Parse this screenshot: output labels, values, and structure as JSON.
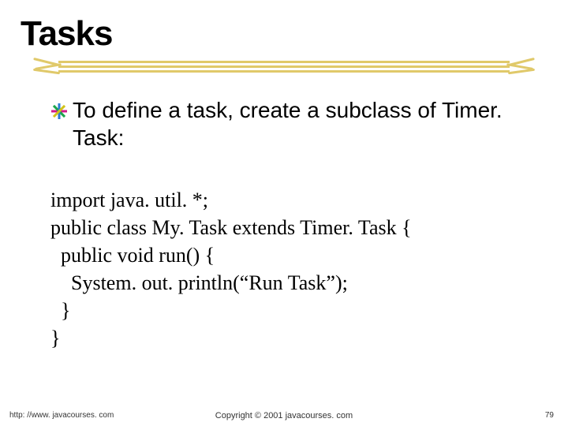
{
  "title": "Tasks",
  "bullet_text": "To define a task, create a subclass of Timer. Task:",
  "code_lines": [
    "import java. util. *;",
    "public class My. Task extends Timer. Task {",
    "  public void run() {",
    "    System. out. println(“Run Task”);",
    "  }",
    "}"
  ],
  "footer": {
    "left": "http: //www. javacourses. com",
    "center": "Copyright © 2001 javacourses. com",
    "page": "79"
  }
}
